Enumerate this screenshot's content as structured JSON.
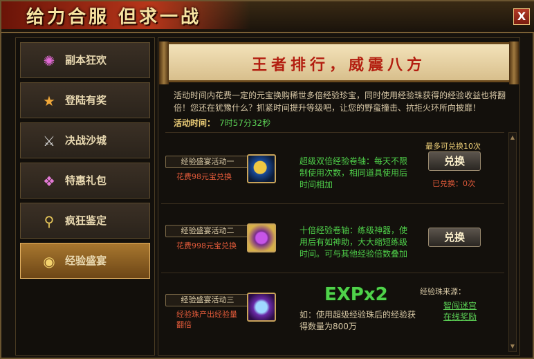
{
  "window": {
    "title": "给力合服 但求一战",
    "close_label": "X"
  },
  "sidebar": {
    "items": [
      {
        "label": "副本狂欢",
        "icon": "fireworks-icon",
        "active": false
      },
      {
        "label": "登陆有奖",
        "icon": "star-icon",
        "active": false
      },
      {
        "label": "决战沙城",
        "icon": "crossed-swords-icon",
        "active": false
      },
      {
        "label": "特惠礼包",
        "icon": "gift-box-icon",
        "active": false
      },
      {
        "label": "疯狂鉴定",
        "icon": "magnifier-icon",
        "active": false
      },
      {
        "label": "经验盛宴",
        "icon": "treasure-pot-icon",
        "active": true
      }
    ]
  },
  "main": {
    "banner": "王者排行，威震八方",
    "description": "活动时间内花费一定的元宝换购稀世多倍经验珍宝，同时使用经验珠获得的经验收益也将翻倍！您还在犹豫什么？抓紧时间提升等级吧，让您的野蛮撞击、抗拒火环所向披靡！",
    "time_label": "活动时间：",
    "time_value": "7时57分32秒",
    "activities": [
      {
        "name": "经验盛宴活动一",
        "cost": "花费98元宝兑换",
        "icon": "exp-scroll-blue-icon",
        "desc": "超级双倍经验卷轴：每天不限制使用次数，相同道具使用后时间相加",
        "max_note": "最多可兑换10次",
        "button": "兑换",
        "exchanged": "已兑换：0次"
      },
      {
        "name": "经验盛宴活动二",
        "cost": "花费998元宝兑换",
        "icon": "exp-scroll-gold-icon",
        "desc": "十倍经验卷轴：练级神器，使用后有如神助，大大缩短练级时间。可与其他经验倍数叠加",
        "button": "兑换"
      },
      {
        "name": "经验盛宴活动三",
        "cost": "经验珠产出经验量翻倍",
        "icon": "exp-orb-icon",
        "exp": "EXPx2",
        "desc": "如：使用超级经验珠后的经验获得数量为800万",
        "source_label": "经验珠来源：",
        "links": [
          "智闯迷宫",
          "在线奖励"
        ]
      }
    ]
  },
  "colors": {
    "accent": "#b31e10",
    "green": "#4fd04a",
    "gold": "#f1d27a",
    "active_tab": "#a8772f"
  }
}
